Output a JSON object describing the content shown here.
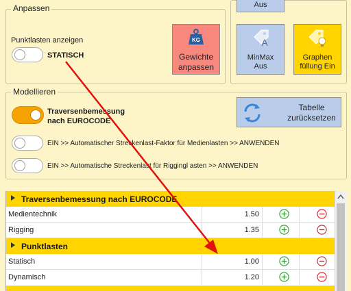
{
  "anpassen": {
    "title": "Anpassen",
    "punktlasten_label": "Punktlasten anzeigen",
    "punktlasten_state": "STATISCH",
    "gewichte_button": "Gewichte anpassen",
    "kg_badge": "KG"
  },
  "tiles": {
    "top_right_partial": "Aus",
    "minmax": "MinMax Aus",
    "graphen": "Graphen füllung Ein"
  },
  "modellieren": {
    "title": "Modellieren",
    "traversen_toggle_label": "Traversenbemessung nach EUROCODE",
    "tabelle_button": "Tabelle zurücksetzen",
    "medien_toggle_label": "EIN >> Automatischer Streckenlast-Faktor für Medienlasten >> ANWENDEN",
    "rigging_toggle_label": "EIN >> Automatische Streckenlast für Riggingl asten >> ANWENDEN"
  },
  "table": {
    "sections": [
      {
        "title": "Traversenbemessung nach EUROCODE",
        "rows": [
          {
            "name": "Medientechnik",
            "value": "1.50"
          },
          {
            "name": "Rigging",
            "value": "1.35"
          }
        ]
      },
      {
        "title": "Punktlasten",
        "rows": [
          {
            "name": "Statisch",
            "value": "1.00"
          },
          {
            "name": "Dynamisch",
            "value": "1.20"
          }
        ]
      }
    ]
  },
  "colors": {
    "background": "#fdf5c8",
    "accent_orange": "#f5a300",
    "section_yellow": "#ffd400",
    "gewichte_red": "#f8877d",
    "tile_blue": "#b9cdea",
    "tile_yellow": "#ffd400",
    "arrow_red": "#e0120c"
  }
}
